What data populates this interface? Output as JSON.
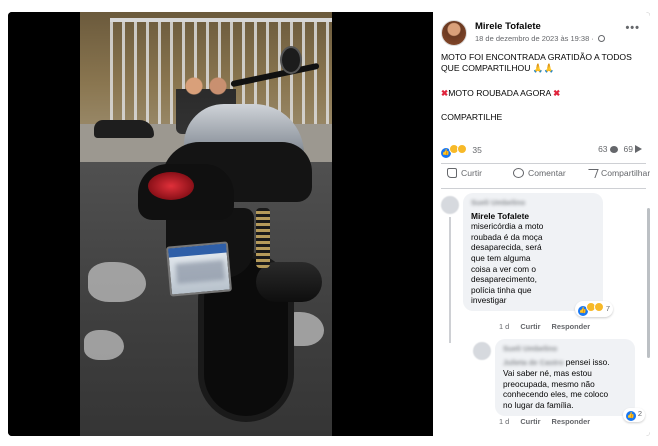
{
  "post": {
    "author": "Mirele Tofalete",
    "date": "18 de dezembro de 2023 às 19:38 · ",
    "more": "•••",
    "line1": "MOTO FOI ENCONTRADA GRATIDÃO A TODOS",
    "line2": "QUE COMPARTILHOU",
    "pray": "🙏🙏",
    "x_left": "✖",
    "stolen": "MOTO ROUBADA AGORA",
    "x_right": "✖",
    "share_call": "COMPARTILHE"
  },
  "stats": {
    "reactions_count": "35",
    "comments_count": "63",
    "shares_count": "69"
  },
  "actions": {
    "like": "Curtir",
    "comment": "Comentar",
    "share": "Compartilhar"
  },
  "comments": [
    {
      "blurred_name": "Sueli Umbelino",
      "author": "Mirele Tofalete",
      "text_lines": [
        "misericórdia a moto",
        "roubada é da moça",
        "desaparecida, será",
        "que tem alguma",
        "coisa a ver com o",
        "desaparecimento,",
        "polícia tinha que",
        "investigar"
      ],
      "react_count": "7",
      "time": "1 d",
      "like": "Curtir",
      "reply": "Responder"
    },
    {
      "blurred_name": "Sueli Umbelino",
      "blurred_name2": "Julieta de Castro",
      "first_line": "pensei isso.",
      "text_lines": [
        "Vai saber né, mas estou",
        "preocupada, mesmo não",
        "conhecendo eles, me coloco",
        "no lugar da família."
      ],
      "react_count": "2",
      "time": "1 d",
      "like": "Curtir",
      "reply": "Responder"
    }
  ],
  "colors": {
    "facebook_blue": "#1877f2",
    "red_x": "#e0243c",
    "comment_bg": "#f0f2f5"
  }
}
